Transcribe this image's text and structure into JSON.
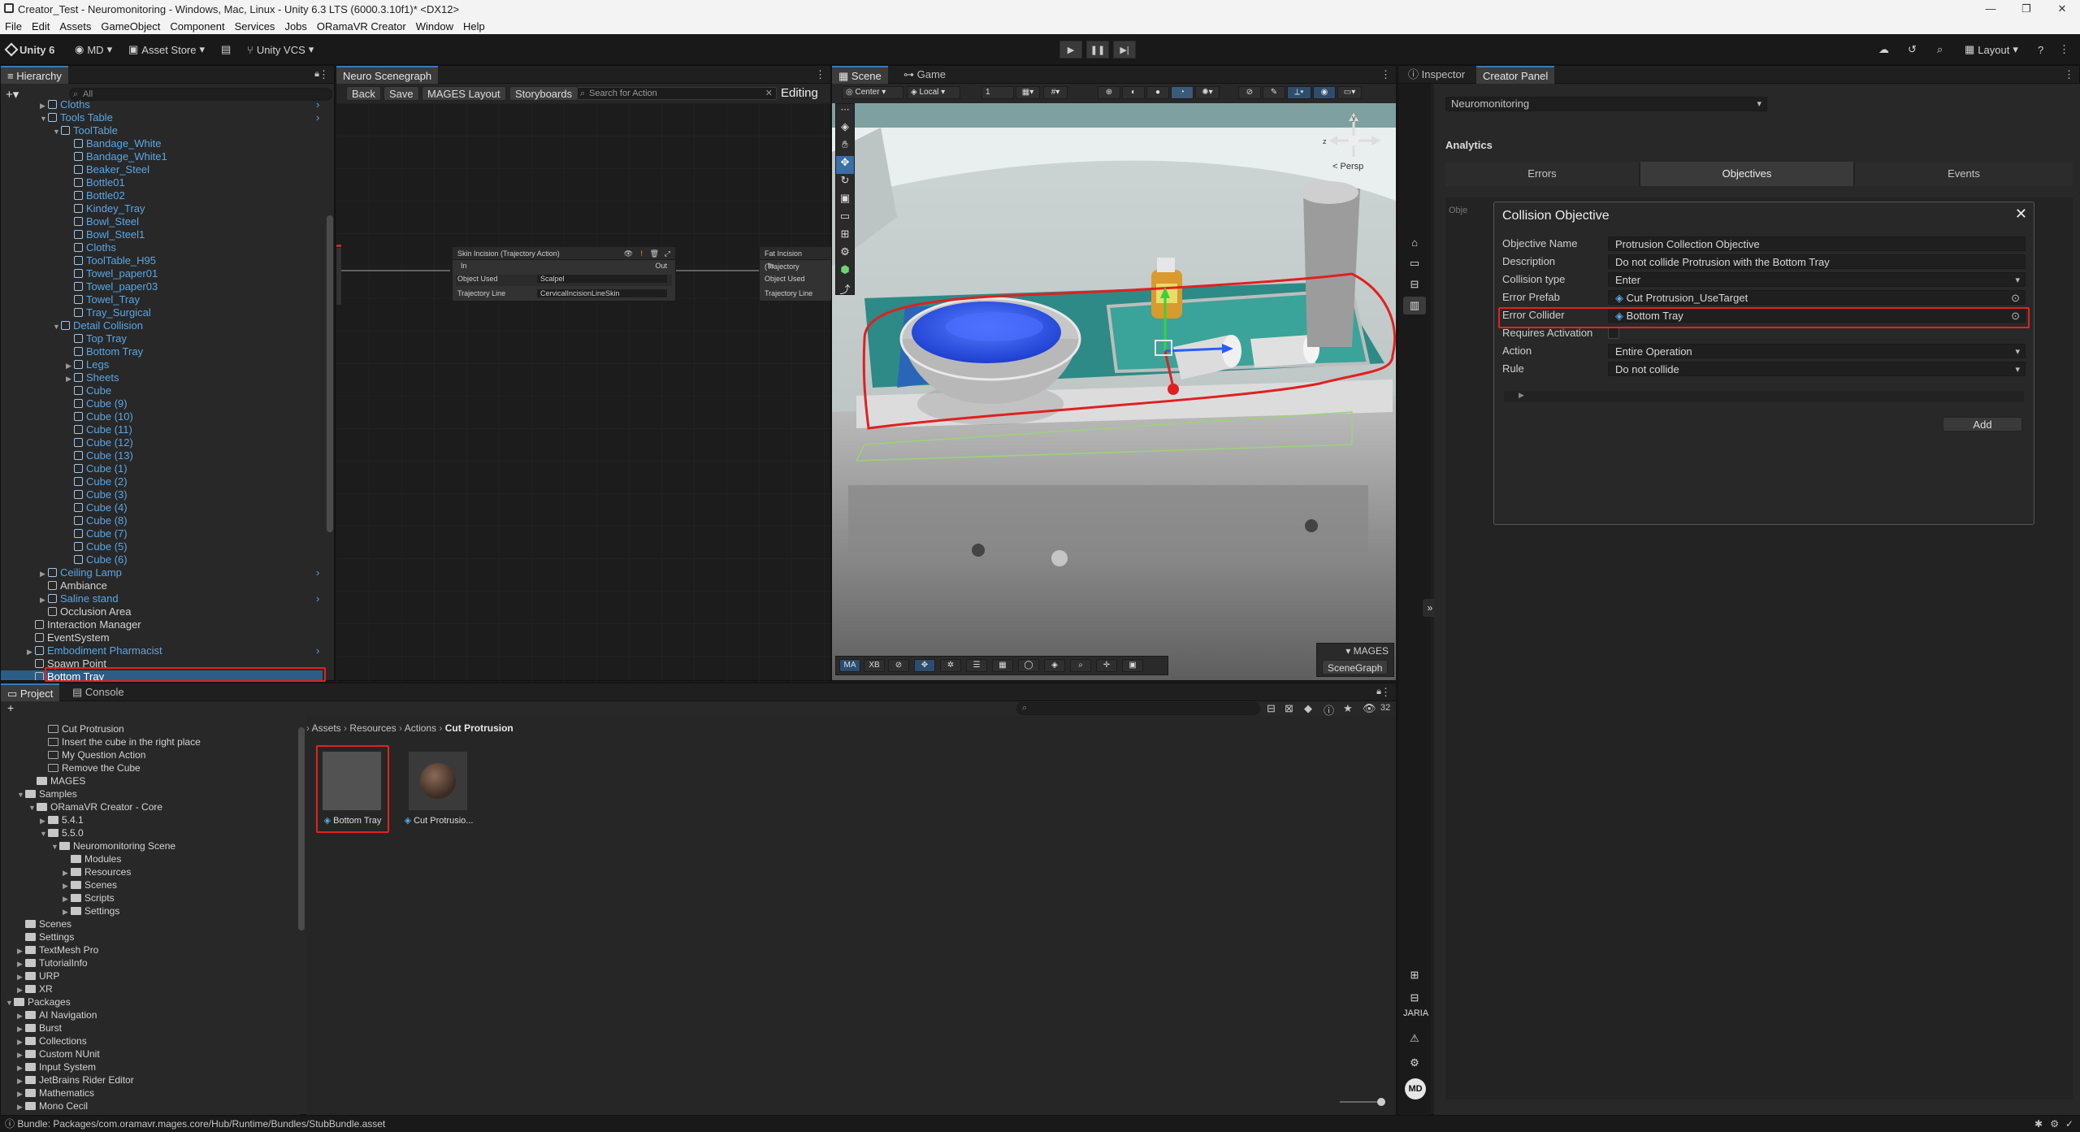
{
  "window": {
    "title": "Creator_Test - Neuromonitoring - Windows, Mac, Linux - Unity 6.3 LTS (6000.3.10f1)* <DX12>"
  },
  "menu": [
    "File",
    "Edit",
    "Assets",
    "GameObject",
    "Component",
    "Services",
    "Jobs",
    "ORamaVR Creator",
    "Window",
    "Help"
  ],
  "toolbar": {
    "unity": "Unity 6",
    "account": "MD",
    "asset_store": "Asset Store",
    "vcs": "Unity VCS",
    "layout": "Layout"
  },
  "hierarchy": {
    "tab": "Hierarchy",
    "search_placeholder": "All",
    "items": [
      {
        "label": "Cloths",
        "indent": 3,
        "color": "blue",
        "arrow": true
      },
      {
        "label": "Tools Table",
        "indent": 3,
        "color": "blue",
        "arrow": true,
        "open": true
      },
      {
        "label": "ToolTable",
        "indent": 4,
        "color": "blue",
        "arrow": true,
        "open": true
      },
      {
        "label": "Bandage_White",
        "indent": 5,
        "color": "blue"
      },
      {
        "label": "Bandage_White1",
        "indent": 5,
        "color": "blue"
      },
      {
        "label": "Beaker_Steel",
        "indent": 5,
        "color": "blue"
      },
      {
        "label": "Bottle01",
        "indent": 5,
        "color": "blue"
      },
      {
        "label": "Bottle02",
        "indent": 5,
        "color": "blue"
      },
      {
        "label": "Kindey_Tray",
        "indent": 5,
        "color": "blue"
      },
      {
        "label": "Bowl_Steel",
        "indent": 5,
        "color": "blue"
      },
      {
        "label": "Bowl_Steel1",
        "indent": 5,
        "color": "blue"
      },
      {
        "label": "Cloths",
        "indent": 5,
        "color": "blue"
      },
      {
        "label": "ToolTable_H95",
        "indent": 5,
        "color": "blue"
      },
      {
        "label": "Towel_paper01",
        "indent": 5,
        "color": "blue"
      },
      {
        "label": "Towel_paper03",
        "indent": 5,
        "color": "blue"
      },
      {
        "label": "Towel_Tray",
        "indent": 5,
        "color": "blue"
      },
      {
        "label": "Tray_Surgical",
        "indent": 5,
        "color": "blue"
      },
      {
        "label": "Detail Collision",
        "indent": 4,
        "color": "blue",
        "arrow": true,
        "open": true
      },
      {
        "label": "Top Tray",
        "indent": 5,
        "color": "blue"
      },
      {
        "label": "Bottom Tray",
        "indent": 5,
        "color": "blue"
      },
      {
        "label": "Legs",
        "indent": 5,
        "color": "blue",
        "arrow": true
      },
      {
        "label": "Sheets",
        "indent": 5,
        "color": "blue",
        "arrow": true
      },
      {
        "label": "Cube",
        "indent": 5,
        "color": "blue"
      },
      {
        "label": "Cube (9)",
        "indent": 5,
        "color": "blue"
      },
      {
        "label": "Cube (10)",
        "indent": 5,
        "color": "blue"
      },
      {
        "label": "Cube (11)",
        "indent": 5,
        "color": "blue"
      },
      {
        "label": "Cube (12)",
        "indent": 5,
        "color": "blue"
      },
      {
        "label": "Cube (13)",
        "indent": 5,
        "color": "blue"
      },
      {
        "label": "Cube (1)",
        "indent": 5,
        "color": "blue"
      },
      {
        "label": "Cube (2)",
        "indent": 5,
        "color": "blue"
      },
      {
        "label": "Cube (3)",
        "indent": 5,
        "color": "blue"
      },
      {
        "label": "Cube (4)",
        "indent": 5,
        "color": "blue"
      },
      {
        "label": "Cube (8)",
        "indent": 5,
        "color": "blue"
      },
      {
        "label": "Cube (7)",
        "indent": 5,
        "color": "blue"
      },
      {
        "label": "Cube (5)",
        "indent": 5,
        "color": "blue"
      },
      {
        "label": "Cube (6)",
        "indent": 5,
        "color": "blue"
      },
      {
        "label": "Ceiling Lamp",
        "indent": 3,
        "color": "blue",
        "arrow": true
      },
      {
        "label": "Ambiance",
        "indent": 3,
        "color": "white"
      },
      {
        "label": "Saline stand",
        "indent": 3,
        "color": "blue",
        "arrow": true
      },
      {
        "label": "Occlusion Area",
        "indent": 3,
        "color": "white"
      },
      {
        "label": "Interaction Manager",
        "indent": 2,
        "color": "white"
      },
      {
        "label": "EventSystem",
        "indent": 2,
        "color": "white"
      },
      {
        "label": "Embodiment Pharmacist",
        "indent": 2,
        "color": "blue",
        "arrow": true
      },
      {
        "label": "Spawn Point",
        "indent": 2,
        "color": "white"
      },
      {
        "label": "Bottom Tray",
        "indent": 2,
        "color": "white",
        "selected": true
      }
    ]
  },
  "scenegraph": {
    "tab": "Neuro Scenegraph",
    "back": "Back",
    "save": "Save",
    "mages_layout": "MAGES Layout",
    "storyboards": "Storyboards",
    "search_placeholder": "Search for Action",
    "mode": "Editing",
    "node1": {
      "title": "Skin Incision (Trajectory Action)",
      "in": "In",
      "out": "Out",
      "f1": "Object Used",
      "v1": "Scalpel",
      "f2": "Trajectory Line",
      "v2": "CervicalIncisionLineSkin"
    },
    "node2": {
      "title": "Fat Incision (Trajectory",
      "in": "In",
      "f1": "Object Used",
      "f2": "Trajectory Line"
    }
  },
  "scene": {
    "tabs": [
      "Scene",
      "Game"
    ],
    "pivot": "Center",
    "space": "Local",
    "grid_value": "1",
    "persp": "Persp",
    "overlay_buttons": [
      "MA",
      "XB"
    ],
    "mages_label": "MAGES",
    "scenegraph_btn": "SceneGraph"
  },
  "inspector": {
    "tabs": [
      "Inspector",
      "Creator Panel"
    ],
    "project_dropdown": "Neuromonitoring",
    "section": "Analytics",
    "subtabs": [
      "Errors",
      "Objectives",
      "Events"
    ],
    "behind_label": "Obje",
    "side_label": "JARIA",
    "avatar": "MD"
  },
  "collision": {
    "title": "Collision Objective",
    "fields": [
      {
        "label": "Objective Name",
        "value": "Protrusion Collection Objective",
        "kind": "text"
      },
      {
        "label": "Description",
        "value": "Do not collide Protrusion with the Bottom Tray",
        "kind": "text"
      },
      {
        "label": "Collision type",
        "value": "Enter",
        "kind": "dropdown"
      },
      {
        "label": "Error Prefab",
        "value": "Cut Protrusion_UseTarget",
        "kind": "object"
      },
      {
        "label": "Error Collider",
        "value": "Bottom Tray",
        "kind": "object",
        "highlight": true
      },
      {
        "label": "Requires Activation",
        "value": "",
        "kind": "checkbox"
      },
      {
        "label": "Action",
        "value": "Entire Operation",
        "kind": "dropdown"
      },
      {
        "label": "Rule",
        "value": "Do not collide",
        "kind": "dropdown"
      }
    ],
    "add": "Add"
  },
  "project": {
    "tabs": [
      "Project",
      "Console"
    ],
    "count": "32",
    "breadcrumb": [
      "Assets",
      "Resources",
      "Actions",
      "Cut Protrusion"
    ],
    "tree": [
      {
        "label": "Cut Protrusion",
        "indent": 3,
        "arrow": false
      },
      {
        "label": "Insert the cube in the right place",
        "indent": 3,
        "arrow": false
      },
      {
        "label": "My Question Action",
        "indent": 3,
        "arrow": false
      },
      {
        "label": "Remove the Cube",
        "indent": 3,
        "arrow": false
      },
      {
        "label": "MAGES",
        "indent": 2,
        "arrow": false
      },
      {
        "label": "Samples",
        "indent": 1,
        "arrow": true,
        "open": true
      },
      {
        "label": "ORamaVR Creator - Core",
        "indent": 2,
        "arrow": true,
        "open": true
      },
      {
        "label": "5.4.1",
        "indent": 3,
        "arrow": true
      },
      {
        "label": "5.5.0",
        "indent": 3,
        "arrow": true,
        "open": true
      },
      {
        "label": "Neuromonitoring Scene",
        "indent": 4,
        "arrow": true,
        "open": true
      },
      {
        "label": "Modules",
        "indent": 5,
        "arrow": false
      },
      {
        "label": "Resources",
        "indent": 5,
        "arrow": true
      },
      {
        "label": "Scenes",
        "indent": 5,
        "arrow": true
      },
      {
        "label": "Scripts",
        "indent": 5,
        "arrow": true
      },
      {
        "label": "Settings",
        "indent": 5,
        "arrow": true
      },
      {
        "label": "Scenes",
        "indent": 1,
        "arrow": false
      },
      {
        "label": "Settings",
        "indent": 1,
        "arrow": false
      },
      {
        "label": "TextMesh Pro",
        "indent": 1,
        "arrow": true
      },
      {
        "label": "TutorialInfo",
        "indent": 1,
        "arrow": true
      },
      {
        "label": "URP",
        "indent": 1,
        "arrow": true
      },
      {
        "label": "XR",
        "indent": 1,
        "arrow": true
      },
      {
        "label": "Packages",
        "indent": 0,
        "arrow": true,
        "open": true
      },
      {
        "label": "AI Navigation",
        "indent": 1,
        "arrow": true
      },
      {
        "label": "Burst",
        "indent": 1,
        "arrow": true
      },
      {
        "label": "Collections",
        "indent": 1,
        "arrow": true
      },
      {
        "label": "Custom NUnit",
        "indent": 1,
        "arrow": true
      },
      {
        "label": "Input System",
        "indent": 1,
        "arrow": true
      },
      {
        "label": "JetBrains Rider Editor",
        "indent": 1,
        "arrow": true
      },
      {
        "label": "Mathematics",
        "indent": 1,
        "arrow": true
      },
      {
        "label": "Mono Cecil",
        "indent": 1,
        "arrow": true
      }
    ],
    "assets": [
      {
        "label": "Bottom Tray",
        "kind": "prefab-grey",
        "highlight": true
      },
      {
        "label": "Cut Protrusio...",
        "kind": "sphere"
      }
    ]
  },
  "status": {
    "text": "Bundle: Packages/com.oramavr.mages.core/Hub/Runtime/Bundles/StubBundle.asset"
  }
}
